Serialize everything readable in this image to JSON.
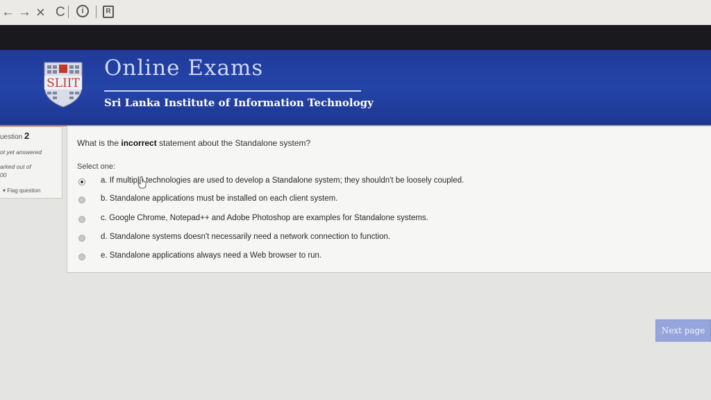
{
  "browser": {
    "back_icon": "←",
    "forward_icon": "→",
    "close_icon": "×",
    "reload_icon": "C",
    "info_icon": "ⓘ"
  },
  "header": {
    "logo_text": "SLIIT",
    "title": "Online Exams",
    "subtitle": "Sri Lanka Institute of Information Technology",
    "background_color": "#2544a8"
  },
  "question_info": {
    "number_prefix": "uestion",
    "number": "2",
    "state": "ot yet answered",
    "marked_out_of": "arked out of",
    "marks": "00",
    "flag_label": "Flag question"
  },
  "question": {
    "prefix": "What is the ",
    "emphasis": "incorrect",
    "suffix": " statement about the Standalone system?",
    "select_one": "Select one:",
    "options": [
      {
        "label": "a. If multiple technologies are used to develop a Standalone system; they shouldn't be loosely coupled.",
        "checked": true
      },
      {
        "label": "b. Standalone applications must be installed on each client system.",
        "checked": false
      },
      {
        "label": "c. Google Chrome, Notepad++ and Adobe Photoshop are examples for Standalone systems.",
        "checked": false
      },
      {
        "label": "d. Standalone systems doesn't necessarily need a network connection to function.",
        "checked": false
      },
      {
        "label": "e. Standalone applications always need a Web browser to run.",
        "checked": false
      }
    ]
  },
  "footer": {
    "next_label": "Next page"
  }
}
